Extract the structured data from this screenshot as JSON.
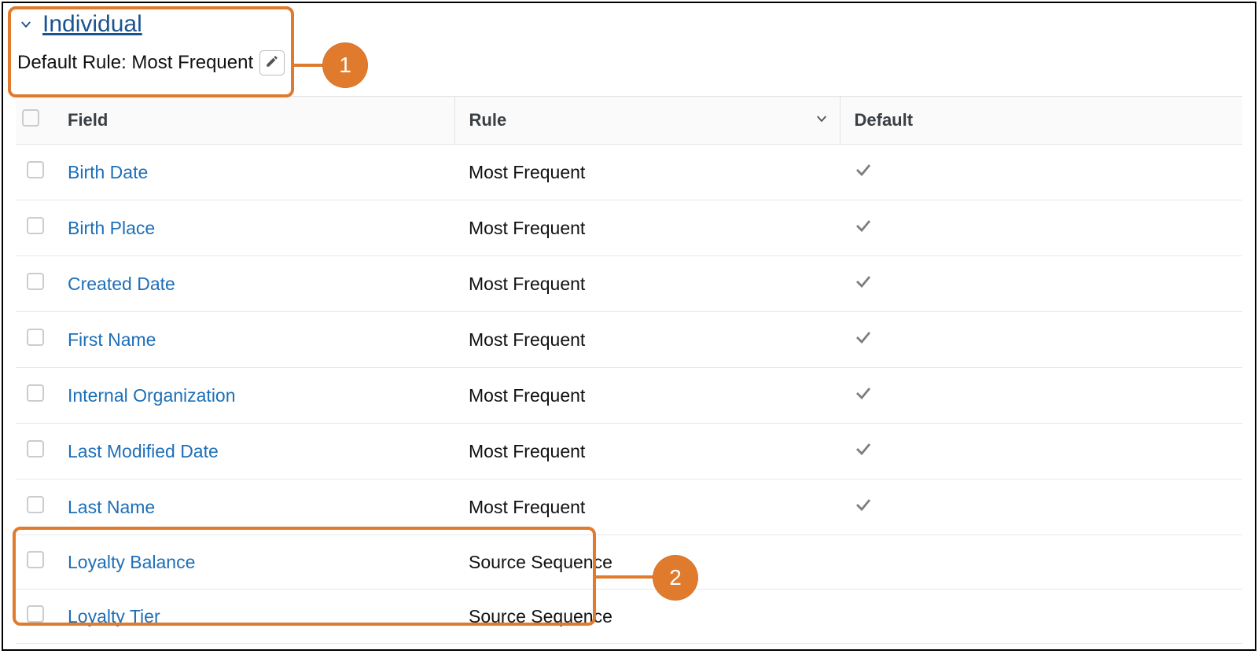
{
  "header": {
    "section_title": "Individual",
    "default_rule_text": "Default Rule: Most Frequent"
  },
  "callouts": [
    {
      "label": "1"
    },
    {
      "label": "2"
    }
  ],
  "table": {
    "headers": {
      "field": "Field",
      "rule": "Rule",
      "default": "Default"
    },
    "rows": [
      {
        "field": "Birth Date",
        "rule": "Most Frequent",
        "default": true
      },
      {
        "field": "Birth Place",
        "rule": "Most Frequent",
        "default": true
      },
      {
        "field": "Created Date",
        "rule": "Most Frequent",
        "default": true
      },
      {
        "field": "First Name",
        "rule": "Most Frequent",
        "default": true
      },
      {
        "field": "Internal Organization",
        "rule": "Most Frequent",
        "default": true
      },
      {
        "field": "Last Modified Date",
        "rule": "Most Frequent",
        "default": true
      },
      {
        "field": "Last Name",
        "rule": "Most Frequent",
        "default": true
      },
      {
        "field": "Loyalty Balance",
        "rule": "Source Sequence",
        "default": false
      },
      {
        "field": "Loyalty Tier",
        "rule": "Source Sequence",
        "default": false
      }
    ]
  }
}
